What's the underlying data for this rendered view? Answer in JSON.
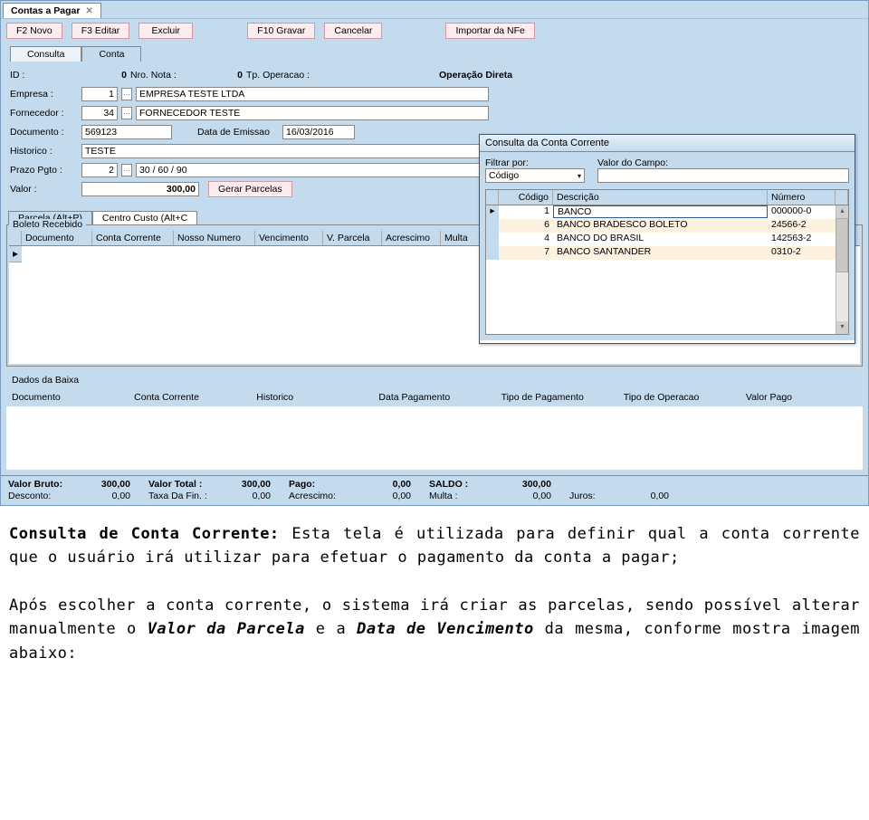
{
  "app_tab": "Contas a Pagar",
  "toolbar": {
    "novo": "F2 Novo",
    "editar": "F3 Editar",
    "excluir": "Excluir",
    "gravar": "F10 Gravar",
    "cancelar": "Cancelar",
    "importar": "Importar da NFe"
  },
  "subtabs": {
    "consulta": "Consulta",
    "conta": "Conta"
  },
  "form": {
    "id_lbl": "ID :",
    "id_val": "0",
    "nro_lbl": "Nro. Nota :",
    "nro_val": "0",
    "tp_lbl": "Tp. Operacao :",
    "opdir": "Operação Direta",
    "empresa_lbl": "Empresa :",
    "empresa_cod": "1",
    "empresa_nome": "EMPRESA TESTE LTDA",
    "forn_lbl": "Fornecedor :",
    "forn_cod": "34",
    "forn_nome": "FORNECEDOR TESTE",
    "doc_lbl": "Documento :",
    "doc_val": "569123",
    "emiss_lbl": "Data de Emissao",
    "emiss_val": "16/03/2016",
    "hist_lbl": "Historico :",
    "hist_val": "TESTE",
    "prazo_lbl": "Prazo Pgto :",
    "prazo_cod": "2",
    "prazo_desc": "30 / 60 / 90",
    "valor_lbl": "Valor :",
    "valor_val": "300,00",
    "gerar": "Gerar Parcelas"
  },
  "gtabs": {
    "parcela": "Parcela (Alt+P)",
    "centro": "Centro Custo (Alt+C"
  },
  "boleto_legend": "Boleto Recebido",
  "grid_cols": [
    "Documento",
    "Conta Corrente",
    "Nosso Numero",
    "Vencimento",
    "V. Parcela",
    "Acrescimo",
    "Multa"
  ],
  "dialog": {
    "title": "Consulta da Conta Corrente",
    "filtrar_lbl": "Filtrar por:",
    "valor_lbl": "Valor do Campo:",
    "filtro_sel": "Código",
    "cols": [
      "Código",
      "Descrição",
      "Número"
    ],
    "rows": [
      {
        "cod": "1",
        "desc": "BANCO",
        "num": "000000-0"
      },
      {
        "cod": "6",
        "desc": "BANCO BRADESCO BOLETO",
        "num": "24566-2"
      },
      {
        "cod": "4",
        "desc": "BANCO DO BRASIL",
        "num": "142563-2"
      },
      {
        "cod": "7",
        "desc": "BANCO SANTANDER",
        "num": "0310-2"
      }
    ]
  },
  "baixa": {
    "title": "Dados da Baixa",
    "cols": [
      "Documento",
      "Conta Corrente",
      "Historico",
      "Data Pagamento",
      "Tipo de Pagamento",
      "Tipo de Operacao",
      "Valor Pago"
    ]
  },
  "totals": {
    "bruto_l": "Valor Bruto:",
    "bruto_v": "300,00",
    "total_l": "Valor Total :",
    "total_v": "300,00",
    "pago_l": "Pago:",
    "pago_v": "0,00",
    "saldo_l": "SALDO :",
    "saldo_v": "300,00",
    "desc_l": "Desconto:",
    "desc_v": "0,00",
    "taxa_l": "Taxa Da Fin. :",
    "taxa_v": "0,00",
    "acr_l": "Acrescimo:",
    "acr_v": "0,00",
    "multa_l": "Multa :",
    "multa_v": "0,00",
    "juros_l": "Juros:",
    "juros_v": "0,00"
  },
  "caption": {
    "t1a": "Consulta de Conta Corrente:",
    "t1b": " Esta tela é utilizada para definir qual a conta corrente que o usuário irá utilizar para efetuar o pagamento da conta a pagar;",
    "t2a": "Após escolher a conta corrente, o sistema irá criar as parcelas, sendo possível alterar manualmente o ",
    "t2b": "Valor da Parcela",
    "t2c": " e a ",
    "t2d": "Data de Vencimento",
    "t2e": " da mesma, conforme mostra imagem abaixo:"
  }
}
